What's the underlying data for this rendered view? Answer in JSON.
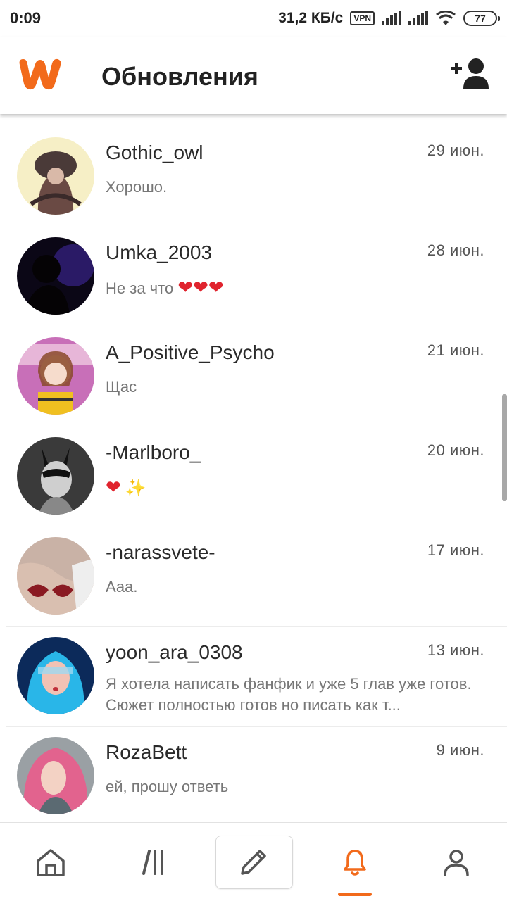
{
  "status_bar": {
    "time": "0:09",
    "network_speed": "31,2 КБ/с",
    "vpn": "VPN",
    "battery": "77"
  },
  "header": {
    "title": "Обновления",
    "brand_color": "#f26a1b"
  },
  "conversations": [
    {
      "username": "Gothic_owl",
      "date": "29 июн.",
      "preview": "Хорошо."
    },
    {
      "username": "Umka_2003",
      "date": "28 июн.",
      "preview": "Не за что",
      "preview_emoji": "❤❤❤"
    },
    {
      "username": "A_Positive_Psycho",
      "date": "21 июн.",
      "preview": "Щас"
    },
    {
      "username": "-Marlboro_",
      "date": "20 июн.",
      "preview_emoji": "❤",
      "preview_emoji_2": "✨"
    },
    {
      "username": "-narassvete-",
      "date": "17 июн.",
      "preview": "Ааа."
    },
    {
      "username": "yoon_ara_0308",
      "date": "13 июн.",
      "preview": "Я хотела написать фанфик и уже 5 глав уже готов. Сюжет полностью готов но писать как т..."
    },
    {
      "username": "RozaBett",
      "date": "9 июн.",
      "preview": "ей, прошу ответь"
    }
  ],
  "bottom_nav": {
    "items": [
      "home-icon",
      "library-icon",
      "pencil-icon",
      "bell-icon",
      "profile-icon"
    ],
    "active": "bell-icon",
    "active_color": "#f26a1b",
    "inactive_color": "#555555"
  }
}
